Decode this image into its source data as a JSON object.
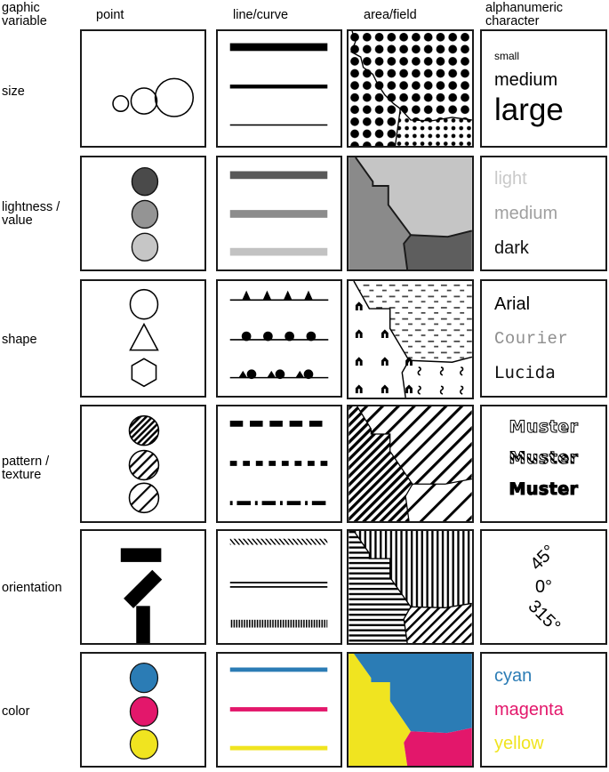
{
  "header": {
    "corner_label": "gaphic\nvariable",
    "columns": [
      {
        "key": "point",
        "label": "point"
      },
      {
        "key": "line",
        "label": "line/curve"
      },
      {
        "key": "area",
        "label": "area/field"
      },
      {
        "key": "alpha",
        "label": "alphanumeric\ncharacter"
      }
    ]
  },
  "rows": [
    {
      "key": "size",
      "label": "size"
    },
    {
      "key": "lightness",
      "label": "lightness /\nvalue"
    },
    {
      "key": "shape",
      "label": "shape"
    },
    {
      "key": "pattern",
      "label": "pattern /\ntexture"
    },
    {
      "key": "orientation",
      "label": "orientation"
    },
    {
      "key": "color",
      "label": "color"
    }
  ],
  "alphanumeric": {
    "size": {
      "items": [
        "small",
        "medium",
        "large"
      ]
    },
    "lightness": {
      "items": [
        "light",
        "medium",
        "dark"
      ]
    },
    "shape": {
      "items": [
        "Arial",
        "Courier",
        "Lucida"
      ]
    },
    "pattern": {
      "items": [
        "Muster",
        "Muster",
        "Muster"
      ]
    },
    "orientation": {
      "items": [
        "45°",
        "0°",
        "315°"
      ]
    },
    "color": {
      "items": [
        "cyan",
        "magenta",
        "yellow"
      ]
    }
  },
  "colors": {
    "cyan": "#2b7cb5",
    "magenta": "#e3176b",
    "yellow": "#f0e420",
    "gray_light": "#c5c5c5",
    "gray_medium": "#8a8a8a",
    "gray_dark": "#5e5e5e",
    "ink": "#000000",
    "text_light": "#c9c9c9",
    "text_medium": "#a0a0a0"
  },
  "point_symbols": {
    "size": [
      "small circle",
      "medium circle",
      "large circle"
    ],
    "lightness": [
      "dark circle",
      "medium circle",
      "light circle"
    ],
    "shape": [
      "circle",
      "triangle",
      "hexagon"
    ],
    "pattern": [
      "dense hatch circle",
      "medium hatch circle",
      "sparse hatch circle"
    ],
    "orientation": [
      "bar 0°",
      "bar 45°",
      "bar 90°"
    ],
    "color": [
      "cyan circle",
      "magenta circle",
      "yellow circle"
    ]
  },
  "line_symbols": {
    "size": [
      "thick line",
      "medium line",
      "thin line"
    ],
    "lightness": [
      "dark band",
      "medium band",
      "light band"
    ],
    "shape": [
      "triangle symbols line",
      "circle symbols line",
      "mixed symbols line"
    ],
    "pattern": [
      "long dash",
      "short dash",
      "dash dot"
    ],
    "orientation": [
      "diagonal hatch line",
      "double line",
      "vertical tick line"
    ],
    "color": [
      "cyan line",
      "magenta line",
      "yellow line"
    ]
  },
  "area_symbols": {
    "size": [
      "large dot screen",
      "small dot screen"
    ],
    "lightness": [
      "medium gray",
      "light gray",
      "dark gray"
    ],
    "shape": [
      "house symbols",
      "dash symbols",
      "tuft symbols"
    ],
    "pattern": [
      "dense diagonal hatch",
      "medium diagonal hatch",
      "sparse diagonal hatch"
    ],
    "orientation": [
      "horizontal lines",
      "vertical lines",
      "45° diagonal lines"
    ],
    "color": [
      "yellow region",
      "cyan region",
      "magenta region"
    ]
  }
}
